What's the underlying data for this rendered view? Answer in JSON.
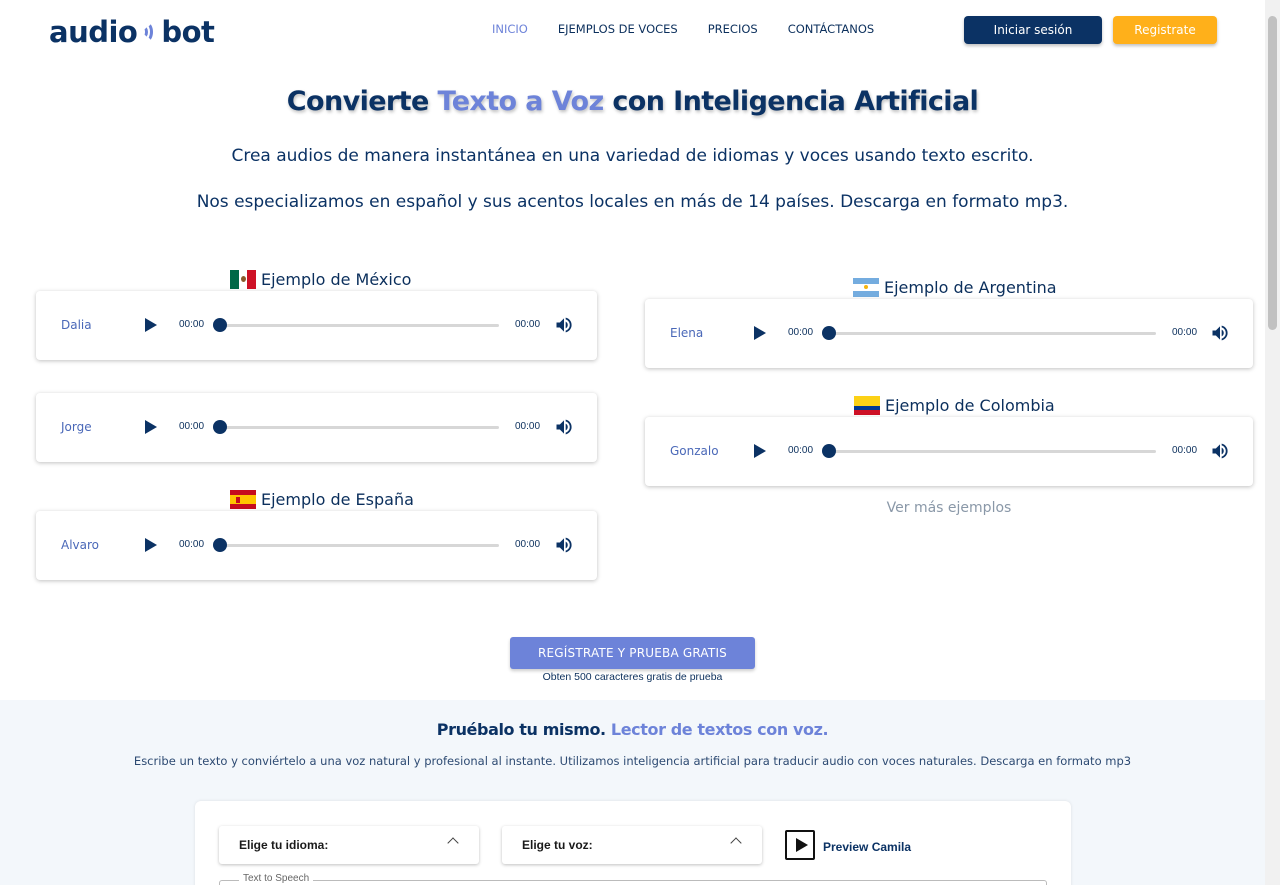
{
  "header": {
    "logo": {
      "left": "audio",
      "right": "bot"
    },
    "nav": [
      {
        "label": "INICIO",
        "active": true
      },
      {
        "label": "EJEMPLOS DE VOCES",
        "active": false
      },
      {
        "label": "PRECIOS",
        "active": false
      },
      {
        "label": "CONTÁCTANOS",
        "active": false
      }
    ],
    "login_label": "Iniciar sesión",
    "register_label": "Registrate"
  },
  "hero": {
    "title_part1": "Convierte ",
    "title_accent": "Texto a Voz",
    "title_part2": " con Inteligencia Artificial",
    "subtitle1": "Crea audios de manera instantánea en una variedad de idiomas y voces usando texto escrito.",
    "subtitle2": "Nos especializamos en español y sus acentos locales en más de 14 países. Descarga en formato mp3."
  },
  "examples": {
    "mexico": {
      "title": "Ejemplo de México",
      "flag": "mexico-flag-icon",
      "voices": [
        {
          "name": "Dalia",
          "current": "00:00",
          "duration": "00:00"
        },
        {
          "name": "Jorge",
          "current": "00:00",
          "duration": "00:00"
        }
      ]
    },
    "spain": {
      "title": "Ejemplo de España",
      "flag": "spain-flag-icon",
      "voices": [
        {
          "name": "Alvaro",
          "current": "00:00",
          "duration": "00:00"
        }
      ]
    },
    "argentina": {
      "title": "Ejemplo de Argentina",
      "flag": "argentina-flag-icon",
      "voices": [
        {
          "name": "Elena",
          "current": "00:00",
          "duration": "00:00"
        }
      ]
    },
    "colombia": {
      "title": "Ejemplo de Colombia",
      "flag": "colombia-flag-icon",
      "voices": [
        {
          "name": "Gonzalo",
          "current": "00:00",
          "duration": "00:00"
        }
      ]
    },
    "more_link": "Ver más ejemplos"
  },
  "cta": {
    "button_label": "REGÍSTRATE Y PRUEBA GRATIS",
    "note": "Obten 500 caracteres gratis de prueba"
  },
  "try_section": {
    "title_part1": "Pruébalo tu mismo. ",
    "title_accent": "Lector de textos con voz.",
    "description": "Escribe un texto y conviértelo a una voz natural y profesional al instante. Utilizamos inteligencia artificial para traducir audio con voces naturales. Descarga en formato mp3",
    "language_select": "Elige tu idioma:",
    "voice_select": "Elige tu voz:",
    "preview_label": "Preview Camila",
    "tts_legend": "Text to Speech"
  },
  "colors": {
    "primary": "#0b3264",
    "accent": "#6d83d9",
    "register": "#ffb01a",
    "section_bg": "#f3f7fb"
  }
}
